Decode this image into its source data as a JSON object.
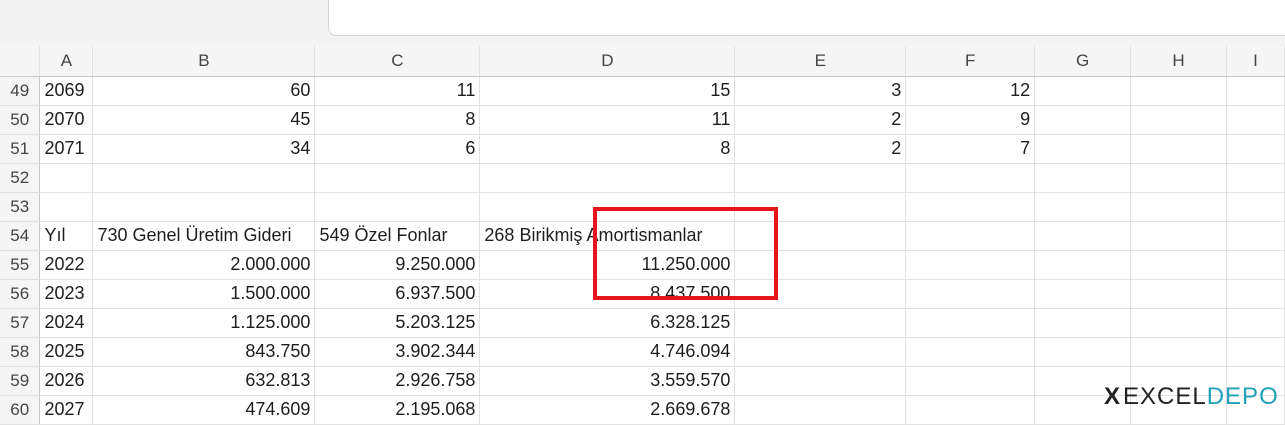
{
  "columns": [
    "A",
    "B",
    "C",
    "D",
    "E",
    "F",
    "G",
    "H",
    "I"
  ],
  "rows": [
    {
      "n": "49",
      "a": "2069",
      "b": "60",
      "c": "11",
      "d": "15",
      "e": "3",
      "f": "12"
    },
    {
      "n": "50",
      "a": "2070",
      "b": "45",
      "c": "8",
      "d": "11",
      "e": "2",
      "f": "9"
    },
    {
      "n": "51",
      "a": "2071",
      "b": "34",
      "c": "6",
      "d": "8",
      "e": "2",
      "f": "7"
    },
    {
      "n": "52",
      "a": "",
      "b": "",
      "c": "",
      "d": "",
      "e": "",
      "f": ""
    },
    {
      "n": "53",
      "a": "",
      "b": "",
      "c": "",
      "d": "",
      "e": "",
      "f": ""
    },
    {
      "n": "54",
      "a": "Yıl",
      "b": "730 Genel Üretim Gideri",
      "c": "549 Özel Fonlar",
      "d": "268 Birikmiş Amortismanlar",
      "e": "",
      "f": ""
    },
    {
      "n": "55",
      "a": "2022",
      "b": "2.000.000",
      "c": "9.250.000",
      "d": "11.250.000",
      "e": "",
      "f": ""
    },
    {
      "n": "56",
      "a": "2023",
      "b": "1.500.000",
      "c": "6.937.500",
      "d": "8.437.500",
      "e": "",
      "f": ""
    },
    {
      "n": "57",
      "a": "2024",
      "b": "1.125.000",
      "c": "5.203.125",
      "d": "6.328.125",
      "e": "",
      "f": ""
    },
    {
      "n": "58",
      "a": "2025",
      "b": "843.750",
      "c": "3.902.344",
      "d": "4.746.094",
      "e": "",
      "f": ""
    },
    {
      "n": "59",
      "a": "2026",
      "b": "632.813",
      "c": "2.926.758",
      "d": "3.559.570",
      "e": "",
      "f": ""
    },
    {
      "n": "60",
      "a": "2027",
      "b": "474.609",
      "c": "2.195.068",
      "d": "2.669.678",
      "e": "",
      "f": ""
    }
  ],
  "logo": {
    "x": "X",
    "excel": "EXCEL",
    "depo": "DEPO"
  },
  "colors": {
    "highlight": "#e8141b",
    "logo_accent": "#20a1b8"
  }
}
